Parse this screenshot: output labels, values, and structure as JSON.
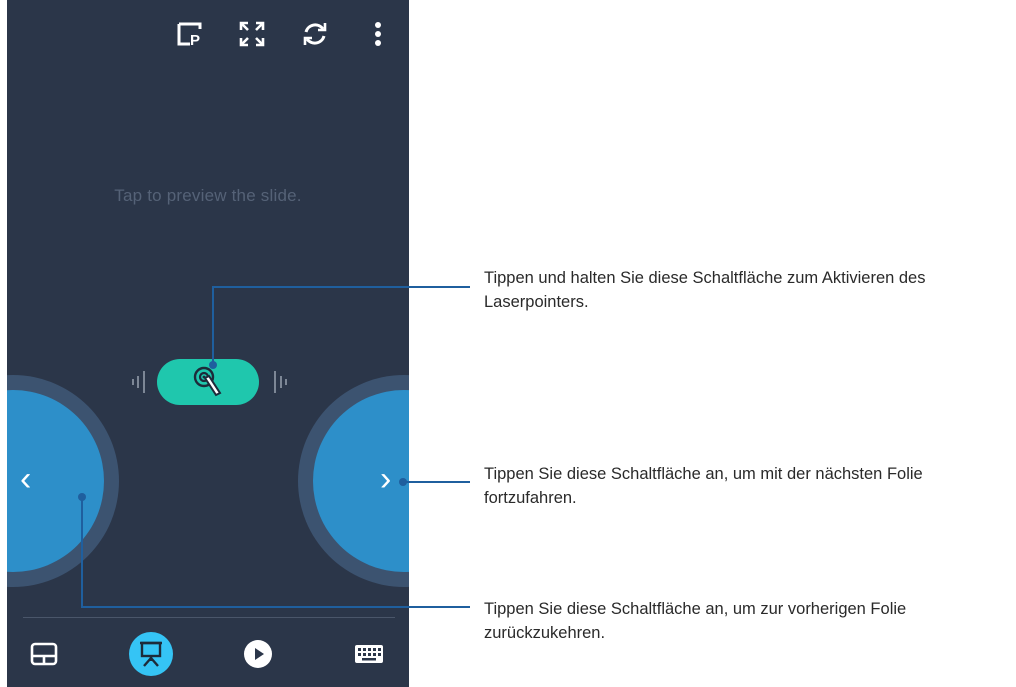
{
  "screen": {
    "preview_hint": "Tap to preview the slide."
  },
  "top_bar": {
    "icons": [
      "presentation-preview-icon",
      "fullscreen-icon",
      "sync-icon",
      "more-vert-icon"
    ]
  },
  "laser": {
    "icon": "laser-pointer-icon",
    "left_icon": "vibration-left-icon",
    "right_icon": "vibration-right-icon"
  },
  "navigation": {
    "prev_label": "‹",
    "next_label": "›"
  },
  "bottom_nav": {
    "items": [
      {
        "icon": "touchpad-icon",
        "active": false
      },
      {
        "icon": "presentation-icon",
        "active": true
      },
      {
        "icon": "play-icon",
        "active": false
      },
      {
        "icon": "keyboard-icon",
        "active": false
      }
    ]
  },
  "annotations": {
    "laser": "Tippen und halten Sie diese Schaltfläche zum Aktivieren des Laserpointers.",
    "next": "Tippen Sie diese Schaltfläche an, um mit der nächsten Folie fortzufahren.",
    "prev": "Tippen Sie diese Schaltfläche an, um zur vorherigen Folie zurückzukehren."
  },
  "colors": {
    "screen_bg": "#2b3649",
    "accent_teal": "#1fc7ad",
    "accent_blue": "#2d8fc9",
    "active_nav": "#35c4f5",
    "callout_line": "#1f5f9e"
  }
}
